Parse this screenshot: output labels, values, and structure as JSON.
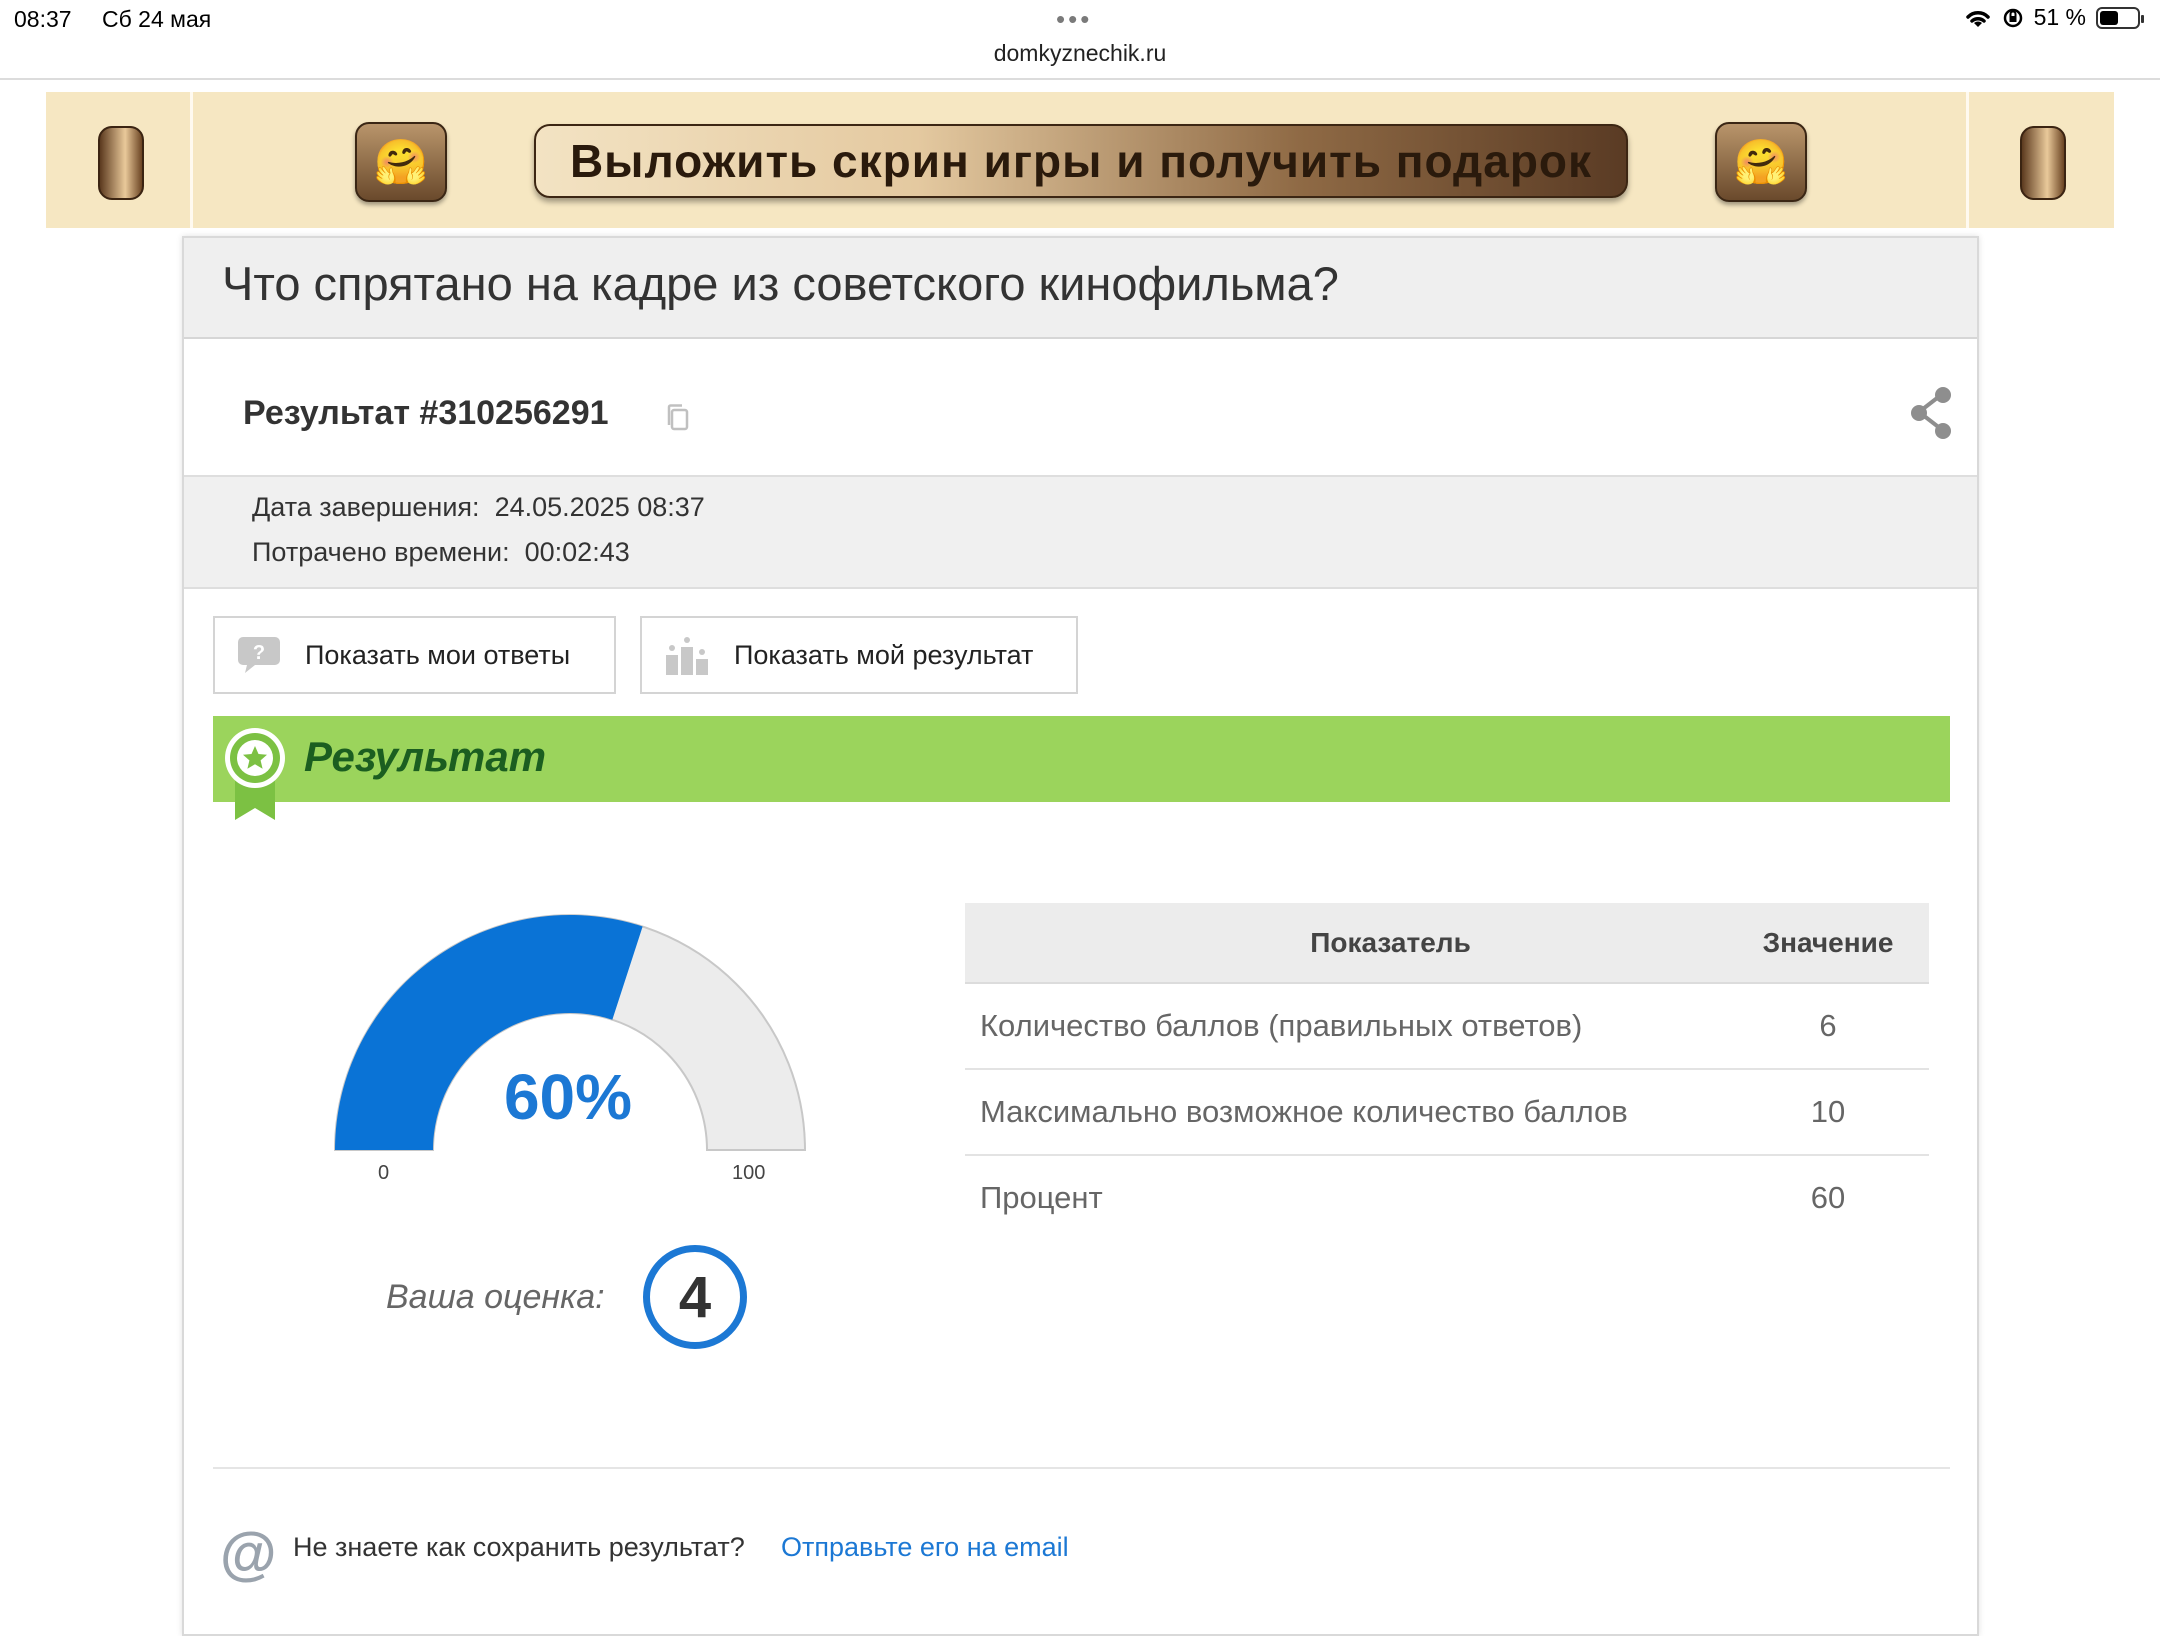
{
  "status_bar": {
    "time": "08:37",
    "date": "Сб 24 мая",
    "dots": "•••",
    "url": "domkyznechik.ru",
    "battery_text": "51 %",
    "battery_level": 0.51
  },
  "banner": {
    "cta_label": "Выложить скрин игры и получить подарок",
    "left_emoji": "🤗",
    "right_emoji": "🤗"
  },
  "page": {
    "title": "Что спрятано на кадре из советского кинофильма?"
  },
  "result": {
    "id_label": "Результат #310256291",
    "completed_label": "Дата завершения:",
    "completed_value": "24.05.2025 08:37",
    "time_label": "Потрачено времени:",
    "time_value": "00:02:43"
  },
  "buttons": {
    "show_answers": "Показать мои ответы",
    "show_result": "Показать мой результат"
  },
  "result_section": {
    "title": "Результат"
  },
  "gauge": {
    "percent": 60,
    "label": "60%",
    "min_label": "0",
    "max_label": "100",
    "fill_color": "#0a73d6",
    "track_color": "#ececec"
  },
  "grade": {
    "label": "Ваша оценка:",
    "value": "4"
  },
  "stats_table": {
    "headers": [
      "Показатель",
      "Значение"
    ],
    "rows": [
      {
        "label": "Количество баллов (правильных ответов)",
        "value": "6"
      },
      {
        "label": "Максимально возможное количество баллов",
        "value": "10"
      },
      {
        "label": "Процент",
        "value": "60"
      }
    ]
  },
  "footer": {
    "question": "Не знаете как сохранить результат?",
    "link": "Отправьте его на email"
  },
  "colors": {
    "accent": "#1c78d4",
    "result_bar": "#9bd45c",
    "result_title": "#1b5e20"
  }
}
